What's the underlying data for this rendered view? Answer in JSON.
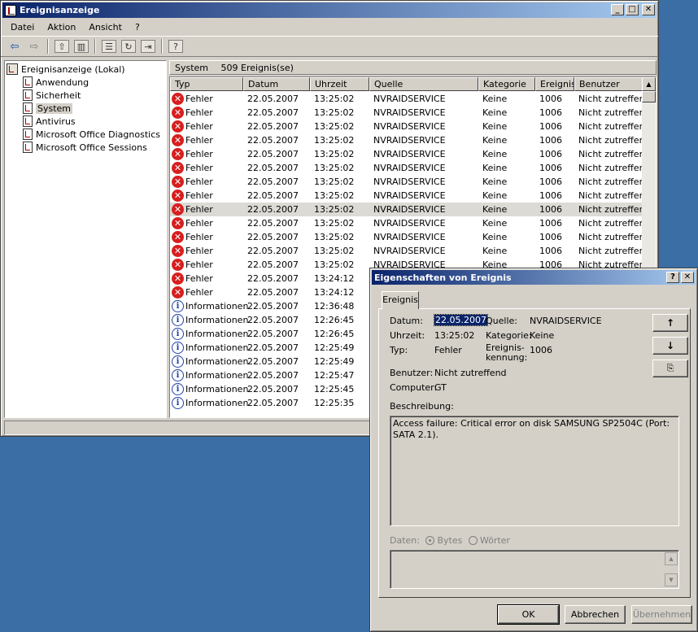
{
  "window": {
    "title": "Ereignisanzeige",
    "controls": [
      "_",
      "□",
      "✕"
    ]
  },
  "menu": [
    "Datei",
    "Aktion",
    "Ansicht",
    "?"
  ],
  "toolbar": {
    "icons": [
      "back-arrow-icon",
      "forward-arrow-icon",
      "up-folder-icon",
      "show-hide-tree-icon",
      "properties-icon",
      "refresh-icon",
      "export-list-icon",
      "help-icon"
    ]
  },
  "tree": {
    "root": "Ereignisanzeige (Lokal)",
    "children": [
      "Anwendung",
      "Sicherheit",
      "System",
      "Antivirus",
      "Microsoft Office Diagnostics",
      "Microsoft Office Sessions"
    ],
    "selected": "System"
  },
  "list": {
    "header_name": "System",
    "header_count": "509 Ereignis(se)",
    "columns": [
      "Typ",
      "Datum",
      "Uhrzeit",
      "Quelle",
      "Kategorie",
      "Ereignis",
      "Benutzer"
    ],
    "rows": [
      {
        "type": "error",
        "typ": "Fehler",
        "datum": "22.05.2007",
        "uhrzeit": "13:25:02",
        "quelle": "NVRAIDSERVICE",
        "kategorie": "Keine",
        "ereignis": "1006",
        "benutzer": "Nicht zutreffend"
      },
      {
        "type": "error",
        "typ": "Fehler",
        "datum": "22.05.2007",
        "uhrzeit": "13:25:02",
        "quelle": "NVRAIDSERVICE",
        "kategorie": "Keine",
        "ereignis": "1006",
        "benutzer": "Nicht zutreffend"
      },
      {
        "type": "error",
        "typ": "Fehler",
        "datum": "22.05.2007",
        "uhrzeit": "13:25:02",
        "quelle": "NVRAIDSERVICE",
        "kategorie": "Keine",
        "ereignis": "1006",
        "benutzer": "Nicht zutreffend"
      },
      {
        "type": "error",
        "typ": "Fehler",
        "datum": "22.05.2007",
        "uhrzeit": "13:25:02",
        "quelle": "NVRAIDSERVICE",
        "kategorie": "Keine",
        "ereignis": "1006",
        "benutzer": "Nicht zutreffend"
      },
      {
        "type": "error",
        "typ": "Fehler",
        "datum": "22.05.2007",
        "uhrzeit": "13:25:02",
        "quelle": "NVRAIDSERVICE",
        "kategorie": "Keine",
        "ereignis": "1006",
        "benutzer": "Nicht zutreffend"
      },
      {
        "type": "error",
        "typ": "Fehler",
        "datum": "22.05.2007",
        "uhrzeit": "13:25:02",
        "quelle": "NVRAIDSERVICE",
        "kategorie": "Keine",
        "ereignis": "1006",
        "benutzer": "Nicht zutreffend"
      },
      {
        "type": "error",
        "typ": "Fehler",
        "datum": "22.05.2007",
        "uhrzeit": "13:25:02",
        "quelle": "NVRAIDSERVICE",
        "kategorie": "Keine",
        "ereignis": "1006",
        "benutzer": "Nicht zutreffend"
      },
      {
        "type": "error",
        "typ": "Fehler",
        "datum": "22.05.2007",
        "uhrzeit": "13:25:02",
        "quelle": "NVRAIDSERVICE",
        "kategorie": "Keine",
        "ereignis": "1006",
        "benutzer": "Nicht zutreffend"
      },
      {
        "type": "error",
        "typ": "Fehler",
        "datum": "22.05.2007",
        "uhrzeit": "13:25:02",
        "quelle": "NVRAIDSERVICE",
        "kategorie": "Keine",
        "ereignis": "1006",
        "benutzer": "Nicht zutreffend",
        "selected": true
      },
      {
        "type": "error",
        "typ": "Fehler",
        "datum": "22.05.2007",
        "uhrzeit": "13:25:02",
        "quelle": "NVRAIDSERVICE",
        "kategorie": "Keine",
        "ereignis": "1006",
        "benutzer": "Nicht zutreffend"
      },
      {
        "type": "error",
        "typ": "Fehler",
        "datum": "22.05.2007",
        "uhrzeit": "13:25:02",
        "quelle": "NVRAIDSERVICE",
        "kategorie": "Keine",
        "ereignis": "1006",
        "benutzer": "Nicht zutreffend"
      },
      {
        "type": "error",
        "typ": "Fehler",
        "datum": "22.05.2007",
        "uhrzeit": "13:25:02",
        "quelle": "NVRAIDSERVICE",
        "kategorie": "Keine",
        "ereignis": "1006",
        "benutzer": "Nicht zutreffend"
      },
      {
        "type": "error",
        "typ": "Fehler",
        "datum": "22.05.2007",
        "uhrzeit": "13:25:02",
        "quelle": "NVRAIDSERVICE",
        "kategorie": "Keine",
        "ereignis": "1006",
        "benutzer": "Nicht zutreffend"
      },
      {
        "type": "error",
        "typ": "Fehler",
        "datum": "22.05.2007",
        "uhrzeit": "13:24:12",
        "quelle": "",
        "kategorie": "",
        "ereignis": "",
        "benutzer": ""
      },
      {
        "type": "error",
        "typ": "Fehler",
        "datum": "22.05.2007",
        "uhrzeit": "13:24:12",
        "quelle": "",
        "kategorie": "",
        "ereignis": "",
        "benutzer": ""
      },
      {
        "type": "info",
        "typ": "Informationen",
        "datum": "22.05.2007",
        "uhrzeit": "12:36:48",
        "quelle": "",
        "kategorie": "",
        "ereignis": "",
        "benutzer": ""
      },
      {
        "type": "info",
        "typ": "Informationen",
        "datum": "22.05.2007",
        "uhrzeit": "12:26:45",
        "quelle": "",
        "kategorie": "",
        "ereignis": "",
        "benutzer": ""
      },
      {
        "type": "info",
        "typ": "Informationen",
        "datum": "22.05.2007",
        "uhrzeit": "12:26:45",
        "quelle": "",
        "kategorie": "",
        "ereignis": "",
        "benutzer": ""
      },
      {
        "type": "info",
        "typ": "Informationen",
        "datum": "22.05.2007",
        "uhrzeit": "12:25:49",
        "quelle": "",
        "kategorie": "",
        "ereignis": "",
        "benutzer": ""
      },
      {
        "type": "info",
        "typ": "Informationen",
        "datum": "22.05.2007",
        "uhrzeit": "12:25:49",
        "quelle": "",
        "kategorie": "",
        "ereignis": "",
        "benutzer": ""
      },
      {
        "type": "info",
        "typ": "Informationen",
        "datum": "22.05.2007",
        "uhrzeit": "12:25:47",
        "quelle": "",
        "kategorie": "",
        "ereignis": "",
        "benutzer": ""
      },
      {
        "type": "info",
        "typ": "Informationen",
        "datum": "22.05.2007",
        "uhrzeit": "12:25:45",
        "quelle": "",
        "kategorie": "",
        "ereignis": "",
        "benutzer": ""
      },
      {
        "type": "info",
        "typ": "Informationen",
        "datum": "22.05.2007",
        "uhrzeit": "12:25:35",
        "quelle": "",
        "kategorie": "",
        "ereignis": "",
        "benutzer": ""
      }
    ]
  },
  "dialog": {
    "title": "Eigenschaften von Ereignis",
    "controls": [
      "?",
      "✕"
    ],
    "tab": "Ereignis",
    "labels": {
      "datum": "Datum:",
      "uhrzeit": "Uhrzeit:",
      "typ": "Typ:",
      "benutzer": "Benutzer:",
      "computer": "Computer:",
      "quelle": "Quelle:",
      "kategorie": "Kategorie:",
      "ereigniskennung": "Ereignis-\nkennung:",
      "beschreibung": "Beschreibung:",
      "daten": "Daten:",
      "bytes": "Bytes",
      "woerter": "Wörter"
    },
    "values": {
      "datum": "22.05.2007",
      "uhrzeit": "13:25:02",
      "typ": "Fehler",
      "benutzer": "Nicht zutreffend",
      "computer": "GT",
      "quelle": "NVRAIDSERVICE",
      "kategorie": "Keine",
      "ereigniskennung": "1006",
      "beschreibung": "Access failure: Critical error on disk SAMSUNG SP2504C (Port: SATA 2.1)."
    },
    "nav": [
      "↑",
      "↓"
    ],
    "buttons": {
      "ok": "OK",
      "cancel": "Abbrechen",
      "apply": "Übernehmen"
    }
  },
  "colors": {
    "desktop": "#3a6ea5",
    "titlebar_start": "#0a246a",
    "titlebar_end": "#a6caf0",
    "error_icon": "#d81e1e",
    "info_icon": "#1c3fa8"
  }
}
